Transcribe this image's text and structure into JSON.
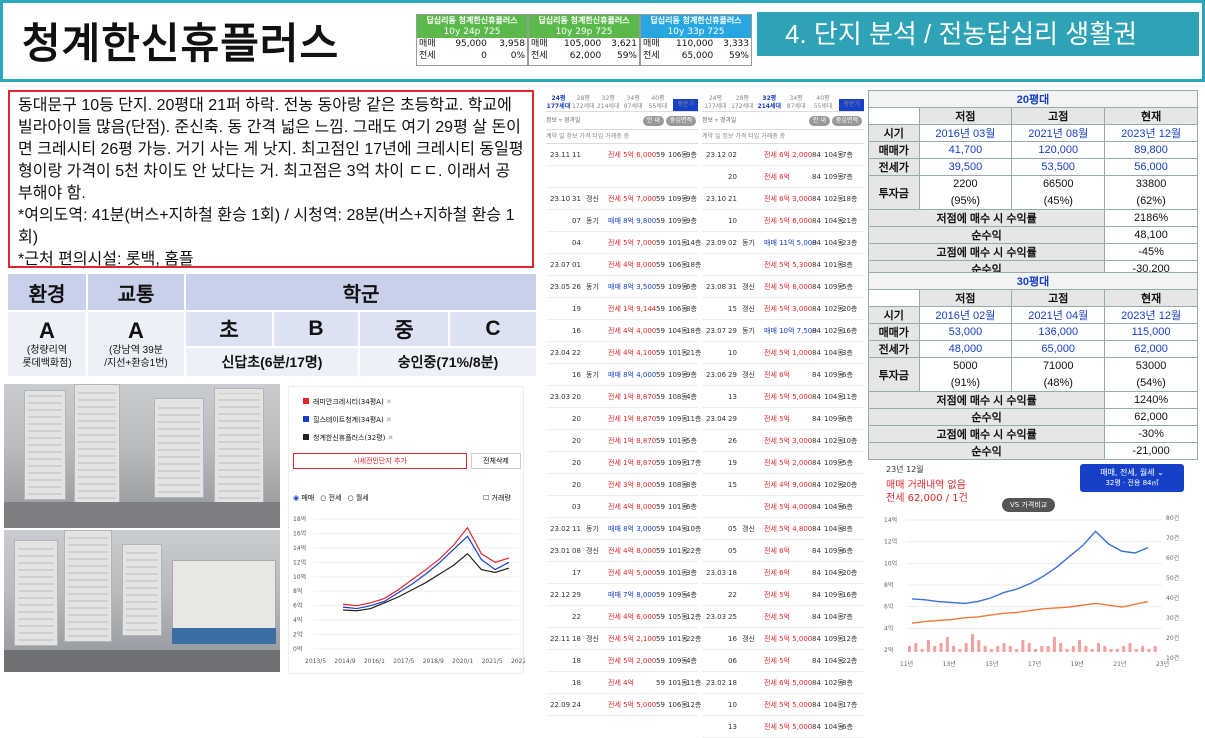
{
  "header": {
    "title": "청계한신휴플러스",
    "section": "4. 단지 분석 / 전농답십리 생활권",
    "price_boxes": [
      {
        "name": "답십리동 청계한신휴플러스",
        "sub": "10y 24p 725",
        "color": "#5ab94a",
        "rows": [
          [
            "매매",
            "95,000",
            "3,958"
          ],
          [
            "전세",
            "0",
            "0%"
          ]
        ]
      },
      {
        "name": "답십리동 청계한신휴플러스",
        "sub": "10y 29p 725",
        "color": "#5ab94a",
        "rows": [
          [
            "매매",
            "105,000",
            "3,621"
          ],
          [
            "전세",
            "62,000",
            "59%"
          ]
        ]
      },
      {
        "name": "답십리동 청계한신휴플러스",
        "sub": "10y 33p 725",
        "color": "#27a7e0",
        "rows": [
          [
            "매매",
            "110,000",
            "3,333"
          ],
          [
            "전세",
            "65,000",
            "59%"
          ]
        ]
      }
    ]
  },
  "description": "동대문구 10등 단지. 20평대 21퍼 하락. 전농 동아랑 같은 초등학교. 학교에 빌라아이들 많음(단점). 준신축. 동 간격 넓은 느낌. 그래도 여기 29평 살 돈이면 크레시티 26평 가능. 거기 사는 게 낫지. 최고점인 17년에 크레시티 동일평형이랑 가격이 5천 차이도 안 났다는 거. 최고점은 3억 차이 ㄷㄷ. 이래서 공부해야 함.\n*여의도역: 41분(버스+지하철 환승 1회) / 시청역: 28분(버스+지하철 환승 1회)\n*근처 편의시설: 롯백, 홈플",
  "rating": {
    "env_label": "환경",
    "traffic_label": "교통",
    "school_label": "학군",
    "env_grade": "A",
    "env_note": "(청량리역\n롯데백화점)",
    "traffic_grade": "A",
    "traffic_note": "(강남역 39분\n/지선+환승1번)",
    "elem_label": "초",
    "elem_grade": "B",
    "mid_label": "중",
    "mid_grade": "C",
    "elem_school": "신답초(6분/17명)",
    "mid_school": "숭인중(71%/8분)"
  },
  "compare": {
    "legend": [
      "래미안크레시티(34평A)",
      "힐스테이트청계(34평A)",
      "청계한신휴플러스(32평)"
    ],
    "legend_colors": [
      "#e3262b",
      "#1740c8",
      "#222222"
    ],
    "add_btn": "시세전인단지 추가",
    "del_btn": "전체삭제",
    "radio": [
      "매매",
      "전세",
      "월세"
    ],
    "check": "거래량",
    "yticks": [
      "18억",
      "16억",
      "14억",
      "12억",
      "10억",
      "8억",
      "6억",
      "4억",
      "2억",
      "0억"
    ],
    "xticks": [
      "2013/5",
      "2014/9",
      "2016/1",
      "2017/5",
      "2018/9",
      "2020/1",
      "2021/5",
      "2022/9"
    ]
  },
  "tx_left": {
    "tabs": [
      "24평\n177세대",
      "28평\n172세대",
      "32평\n214세대",
      "34평\n87세대",
      "40평\n55세대"
    ],
    "active": 0,
    "btn": "평문기",
    "filter": "정보 ▿ 경과일",
    "pills": [
      "중심면적",
      "안 내"
    ],
    "cols": "계약  일  정보        가격           타입  거래층  층",
    "rows": [
      [
        "23.11",
        "11",
        "",
        "전세 5억 6,000",
        "59",
        "106동",
        "9층"
      ],
      [
        "",
        "",
        "",
        "",
        "",
        "",
        ""
      ],
      [
        "23.10",
        "31",
        "갱신",
        "전세 5억 7,000",
        "59",
        "109동",
        "9층"
      ],
      [
        "",
        "07",
        "동기",
        "매매 8억 9,800",
        "59",
        "109동",
        "9층"
      ],
      [
        "",
        "04",
        "",
        "전세 5억 7,000",
        "59",
        "101동",
        "14층"
      ],
      [
        "23.07",
        "01",
        "",
        "전세 4억 8,000",
        "59",
        "106동",
        "18층"
      ],
      [
        "23.05",
        "26",
        "동기",
        "매매 8억 3,500",
        "59",
        "109동",
        "6층"
      ],
      [
        "",
        "19",
        "",
        "전세 1억 9,144",
        "59",
        "106동",
        "8층"
      ],
      [
        "",
        "16",
        "",
        "전세 4억 4,000",
        "59",
        "104동",
        "18층"
      ],
      [
        "23.04",
        "22",
        "",
        "전세 4억 4,100",
        "59",
        "101동",
        "21층"
      ],
      [
        "",
        "16",
        "동기",
        "매매 8억 4,000",
        "59",
        "109동",
        "9층"
      ],
      [
        "23.03",
        "20",
        "",
        "전세 1억 8,870",
        "59",
        "108동",
        "4층"
      ],
      [
        "",
        "20",
        "",
        "전세 1억 8,870",
        "59",
        "109동",
        "11층"
      ],
      [
        "",
        "20",
        "",
        "전세 1억 8,870",
        "59",
        "101동",
        "5층"
      ],
      [
        "",
        "20",
        "",
        "전세 1억 8,870",
        "59",
        "109동",
        "17층"
      ],
      [
        "",
        "20",
        "",
        "전세 3억 8,000",
        "59",
        "108동",
        "8층"
      ],
      [
        "",
        "03",
        "",
        "전세 4억 8,000",
        "59",
        "101동",
        "6층"
      ],
      [
        "23.02",
        "11",
        "동기",
        "매매 8억 3,000",
        "59",
        "104동",
        "10층"
      ],
      [
        "23.01",
        "08",
        "갱신",
        "전세 4억 8,000",
        "59",
        "101동",
        "22층"
      ],
      [
        "",
        "17",
        "",
        "전세 4억 5,000",
        "59",
        "101동",
        "3층"
      ],
      [
        "22.12",
        "29",
        "",
        "매매 7억 8,000",
        "59",
        "109동",
        "4층"
      ],
      [
        "",
        "22",
        "",
        "전세 4억 6,000",
        "59",
        "105동",
        "12층"
      ],
      [
        "22.11",
        "18",
        "갱신",
        "전세 5억 2,100",
        "59",
        "101동",
        "22층"
      ],
      [
        "",
        "18",
        "",
        "전세 5억 2,000",
        "59",
        "109동",
        "4층"
      ],
      [
        "",
        "18",
        "",
        "전세 4억",
        "59",
        "101동",
        "11층"
      ],
      [
        "22.09",
        "24",
        "",
        "전세 5억 5,000",
        "59",
        "106동",
        "12층"
      ]
    ]
  },
  "tx_right": {
    "tabs": [
      "24평\n177세대",
      "28평\n172세대",
      "32평\n214세대",
      "34평\n87세대",
      "40평\n55세대"
    ],
    "active": 2,
    "btn": "평문기",
    "filter": "정보 ▿ 경과일",
    "pills": [
      "중심면적",
      "안 내"
    ],
    "cols": "계약  일  정보        가격           타입  거래층  층",
    "rows": [
      [
        "23.12",
        "02",
        "",
        "전세 6억 2,000",
        "84",
        "104동",
        "7층"
      ],
      [
        "",
        "20",
        "",
        "전세 6억",
        "84",
        "109동",
        "7층"
      ],
      [
        "23.10",
        "21",
        "",
        "전세 6억 3,000",
        "84",
        "102동",
        "18층"
      ],
      [
        "",
        "10",
        "",
        "전세 5억 6,000",
        "84",
        "104동",
        "21층"
      ],
      [
        "23.09",
        "02",
        "동기",
        "매매 11억 5,000",
        "84",
        "104동",
        "23층"
      ],
      [
        "",
        "",
        "",
        "전세 5억 5,300",
        "84",
        "101동",
        "3층"
      ],
      [
        "23.08",
        "31",
        "갱신",
        "전세 5억 8,000",
        "84",
        "109동",
        "5층"
      ],
      [
        "",
        "15",
        "갱신",
        "전세 5억 3,000",
        "84",
        "102동",
        "20층"
      ],
      [
        "23.07",
        "29",
        "동기",
        "매매 10억 7,500",
        "84",
        "102동",
        "16층"
      ],
      [
        "",
        "10",
        "",
        "전세 5억 1,000",
        "84",
        "104동",
        "3층"
      ],
      [
        "23.06",
        "29",
        "갱신",
        "전세 6억",
        "84",
        "109동",
        "6층"
      ],
      [
        "",
        "13",
        "",
        "전세 5억 5,000",
        "84",
        "104동",
        "11층"
      ],
      [
        "23.04",
        "29",
        "",
        "전세 5억",
        "84",
        "109동",
        "6층"
      ],
      [
        "",
        "26",
        "",
        "전세 5억 3,000",
        "84",
        "102동",
        "10층"
      ],
      [
        "",
        "19",
        "",
        "전세 5억 2,000",
        "84",
        "109동",
        "5층"
      ],
      [
        "",
        "15",
        "",
        "전세 4억 9,000",
        "84",
        "102동",
        "20층"
      ],
      [
        "",
        "",
        "",
        "전세 5억 4,000",
        "84",
        "104동",
        "6층"
      ],
      [
        "",
        "05",
        "갱신",
        "전세 5억 4,800",
        "84",
        "104동",
        "8층"
      ],
      [
        "",
        "05",
        "",
        "전세 6억",
        "84",
        "109동",
        "6층"
      ],
      [
        "23.03",
        "18",
        "",
        "전세 6억",
        "84",
        "104동",
        "20층"
      ],
      [
        "",
        "22",
        "",
        "전세 5억",
        "84",
        "109동",
        "16층"
      ],
      [
        "23.03",
        "25",
        "",
        "전세 5억",
        "84",
        "104동",
        "7층"
      ],
      [
        "",
        "16",
        "갱신",
        "전세 5억 5,000",
        "84",
        "109동",
        "12층"
      ],
      [
        "",
        "06",
        "",
        "전세 5억",
        "84",
        "104동",
        "22층"
      ],
      [
        "23.02",
        "18",
        "",
        "전세 6억 5,000",
        "84",
        "102동",
        "8층"
      ],
      [
        "",
        "10",
        "",
        "전세 5억 5,000",
        "84",
        "104동",
        "17층"
      ],
      [
        "",
        "13",
        "",
        "전세 5억 5,000",
        "84",
        "104동",
        "6층"
      ]
    ]
  },
  "analysis": {
    "t20": {
      "caption": "20평대",
      "head": [
        "저점",
        "고점",
        "현재"
      ],
      "rows": [
        {
          "label": "시기",
          "vals": [
            "2016년 03월",
            "2021년 08월",
            "2023년 12월"
          ]
        },
        {
          "label": "매매가",
          "vals": [
            "41,700",
            "120,000",
            "89,800"
          ]
        },
        {
          "label": "전세가",
          "vals": [
            "39,500",
            "53,500",
            "56,000"
          ]
        }
      ],
      "invest_label": "투자금",
      "invest": [
        "2200",
        "66500",
        "33800"
      ],
      "invest_pct": [
        "(95%)",
        "(45%)",
        "(62%)"
      ],
      "summary": [
        [
          "저점에 매수 시 수익률",
          "2186%"
        ],
        [
          "순수익",
          "48,100"
        ],
        [
          "고점에 매수 시 수익률",
          "-45%"
        ],
        [
          "순수익",
          "-30,200"
        ]
      ]
    },
    "t30": {
      "caption": "30평대",
      "head": [
        "저점",
        "고점",
        "현재"
      ],
      "rows": [
        {
          "label": "시기",
          "vals": [
            "2016년 02월",
            "2021년 04월",
            "2023년 12월"
          ]
        },
        {
          "label": "매매가",
          "vals": [
            "53,000",
            "136,000",
            "115,000"
          ]
        },
        {
          "label": "전세가",
          "vals": [
            "48,000",
            "65,000",
            "62,000"
          ]
        }
      ],
      "invest_label": "투자금",
      "invest": [
        "5000",
        "71000",
        "53000"
      ],
      "invest_pct": [
        "(91%)",
        "(48%)",
        "(54%)"
      ],
      "summary": [
        [
          "저점에 매수 시 수익률",
          "1240%"
        ],
        [
          "순수익",
          "62,000"
        ],
        [
          "고점에 매수 시 수익률",
          "-30%"
        ],
        [
          "순수익",
          "-21,000"
        ]
      ]
    }
  },
  "trend": {
    "date": "23년 12월",
    "line1": "매매 거래내역 없음",
    "line2": "전세 62,000 / 1건",
    "select": "매매, 전세, 월세 ⌄",
    "select2": "32평 · 전용 84㎡",
    "vs": "VS 가격비교",
    "yleft": [
      "14억",
      "12억",
      "10억",
      "8억",
      "6억",
      "4억",
      "2억"
    ],
    "yright": [
      "80건",
      "70건",
      "60건",
      "50건",
      "40건",
      "30건",
      "20건",
      "10건"
    ],
    "xticks": [
      "11년",
      "13년",
      "15년",
      "17년",
      "19년",
      "21년",
      "23년"
    ]
  }
}
